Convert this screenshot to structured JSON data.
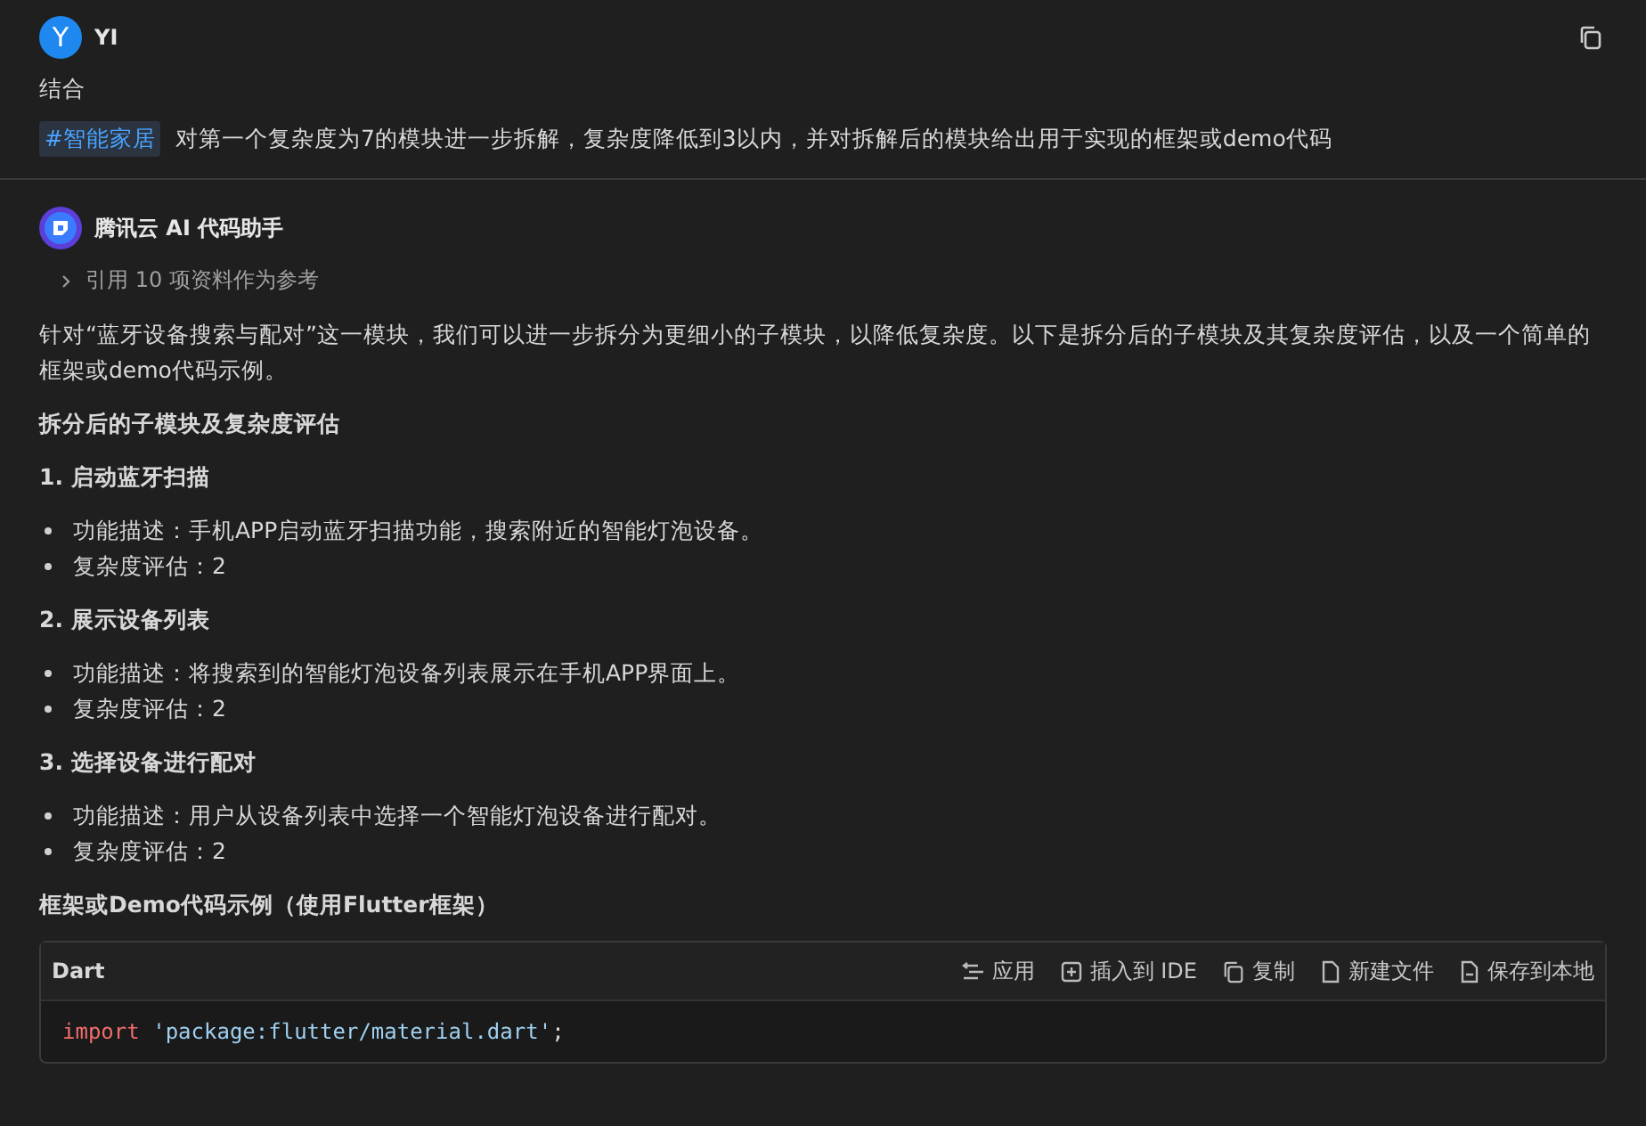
{
  "user_message": {
    "avatar": "Y",
    "name": "YI",
    "lines": [
      "结合"
    ],
    "tag": "#智能家居",
    "text": "对第一个复杂度为7的模块进一步拆解，复杂度降低到3以内，并对拆解后的模块给出用于实现的框架或demo代码"
  },
  "assistant_message": {
    "name": "腾讯云 AI 代码助手",
    "references": {
      "label": "引用 10 项资料作为参考",
      "expanded": false
    },
    "intro": "针对“蓝牙设备搜索与配对”这一模块，我们可以进一步拆分为更细小的子模块，以降低复杂度。以下是拆分后的子模块及其复杂度评估，以及一个简单的框架或demo代码示例。",
    "heading": "拆分后的子模块及复杂度评估",
    "sections": [
      {
        "title": "1. 启动蓝牙扫描",
        "items": [
          "功能描述：手机APP启动蓝牙扫描功能，搜索附近的智能灯泡设备。",
          "复杂度评估：2"
        ]
      },
      {
        "title": "2. 展示设备列表",
        "items": [
          "功能描述：将搜索到的智能灯泡设备列表展示在手机APP界面上。",
          "复杂度评估：2"
        ]
      },
      {
        "title": "3. 选择设备进行配对",
        "items": [
          "功能描述：用户从设备列表中选择一个智能灯泡设备进行配对。",
          "复杂度评估：2"
        ]
      }
    ],
    "code_heading": "框架或Demo代码示例（使用Flutter框架）",
    "code_block": {
      "language": "Dart",
      "actions": [
        {
          "kind": "apply",
          "label": "应用"
        },
        {
          "kind": "insert",
          "label": "插入到 IDE"
        },
        {
          "kind": "copy",
          "label": "复制"
        },
        {
          "kind": "new-file",
          "label": "新建文件"
        },
        {
          "kind": "save",
          "label": "保存到本地"
        }
      ],
      "lines": [
        [
          {
            "kind": "keyword",
            "text": "import"
          },
          {
            "kind": "string",
            "text": "'package:flutter/material.dart'"
          },
          {
            "kind": "plain",
            "text": ";"
          }
        ]
      ]
    }
  }
}
